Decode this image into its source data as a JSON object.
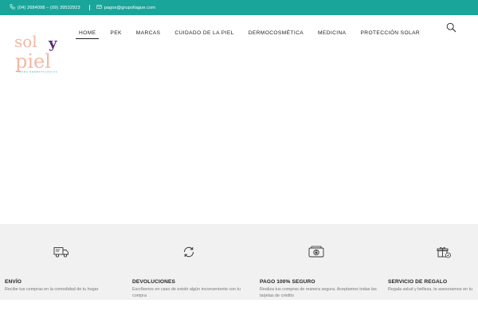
{
  "topbar": {
    "phone": "(04) 2684098 – (09) 39532923",
    "email": "pagos@grupollague.com",
    "phone_icon": "phone-icon",
    "email_icon": "envelope-icon",
    "background": "#1aa59b"
  },
  "logo": {
    "word1": "sol",
    "word2": "y",
    "word3": "piel",
    "tagline": "TIENDA DERMATOLÓGICA",
    "colors": {
      "pink": "#f3b8a4",
      "purple": "#5b2a7a",
      "teal": "#2aa6a0"
    }
  },
  "nav": {
    "items": [
      {
        "label": "HOME"
      },
      {
        "label": "PEK"
      },
      {
        "label": "MARCAS"
      },
      {
        "label": "CUIDADO DE LA PIEL"
      },
      {
        "label": "DERMOCOSMÉTICA"
      },
      {
        "label": "MEDICINA"
      },
      {
        "label": "PROTECCIÓN SOLAR"
      }
    ],
    "active": "HOME",
    "search_icon": "search-icon"
  },
  "features": [
    {
      "icon": "truck-icon",
      "title": "ENVÍO",
      "description": "Recibe tus compras en la comodidad de tu hogar"
    },
    {
      "icon": "refresh-icon",
      "title": "DEVOLUCIONES",
      "description": "Escríbenos en caso de existir algún inconveniente con tu compra"
    },
    {
      "icon": "secure-payment-icon",
      "title": "PAGO 100% SEGURO",
      "description": "Realiza tus compras de manera segura. Aceptamos todas las tarjetas de crédito"
    },
    {
      "icon": "gift-icon",
      "title": "SERVICIO DE REGALO",
      "description": "Regala salud y belleza, te asesoramos en tu"
    }
  ]
}
